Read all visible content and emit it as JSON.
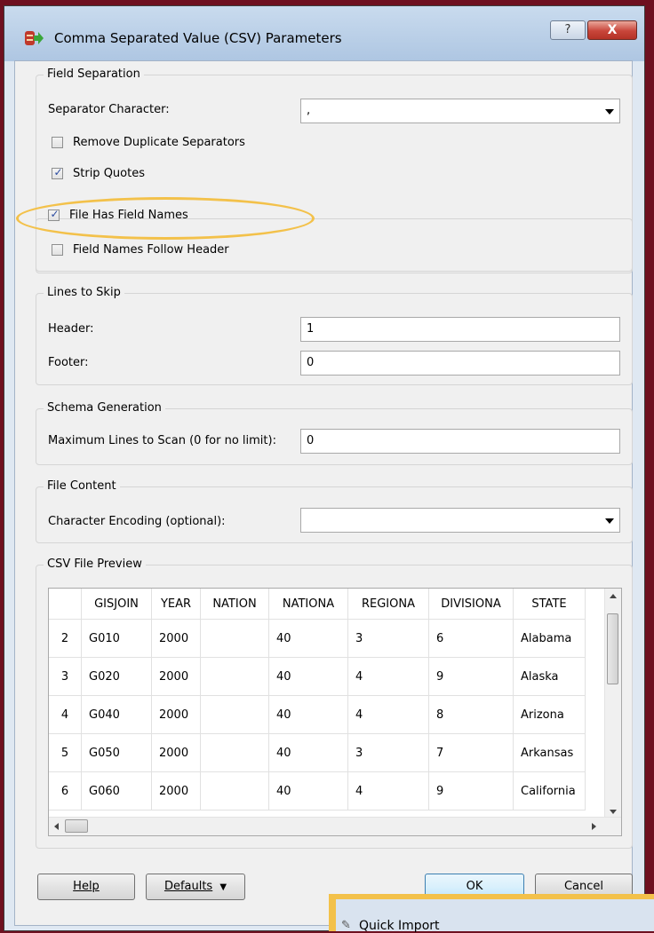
{
  "window": {
    "title": "Comma Separated Value (CSV) Parameters",
    "help_glyph": "?",
    "close_glyph": "X"
  },
  "field_separation": {
    "legend": "Field Separation",
    "separator_label": "Separator Character:",
    "separator_value": ",",
    "remove_duplicates_label": "Remove Duplicate Separators",
    "remove_duplicates_checked": false,
    "strip_quotes_label": "Strip Quotes",
    "strip_quotes_checked": true,
    "file_has_field_names_label": "File Has Field Names",
    "file_has_field_names_checked": true,
    "field_names_follow_header_label": "Field Names Follow Header",
    "field_names_follow_header_checked": false
  },
  "lines_to_skip": {
    "legend": "Lines to Skip",
    "header_label": "Header:",
    "header_value": "1",
    "footer_label": "Footer:",
    "footer_value": "0"
  },
  "schema_generation": {
    "legend": "Schema Generation",
    "max_lines_label": "Maximum Lines to Scan (0 for no limit):",
    "max_lines_value": "0"
  },
  "file_content": {
    "legend": "File Content",
    "encoding_label": "Character Encoding (optional):",
    "encoding_value": ""
  },
  "preview": {
    "legend": "CSV File Preview",
    "columns": [
      "",
      "GISJOIN",
      "YEAR",
      "NATION",
      "NATIONA",
      "REGIONA",
      "DIVISIONA",
      "STATE"
    ],
    "rows": [
      [
        "2",
        "G010",
        "2000",
        "",
        "40",
        "3",
        "6",
        "Alabama"
      ],
      [
        "3",
        "G020",
        "2000",
        "",
        "40",
        "4",
        "9",
        "Alaska"
      ],
      [
        "4",
        "G040",
        "2000",
        "",
        "40",
        "4",
        "8",
        "Arizona"
      ],
      [
        "5",
        "G050",
        "2000",
        "",
        "40",
        "3",
        "7",
        "Arkansas"
      ],
      [
        "6",
        "G060",
        "2000",
        "",
        "40",
        "4",
        "9",
        "California"
      ]
    ]
  },
  "buttons": {
    "help": "Help",
    "defaults": "Defaults",
    "ok": "OK",
    "cancel": "Cancel"
  },
  "background_window": {
    "title": "Quick Import"
  },
  "colors": {
    "highlight": "#f3c14a",
    "desktop_background": "#6e1020",
    "dialog_face": "#f0f0f0"
  }
}
